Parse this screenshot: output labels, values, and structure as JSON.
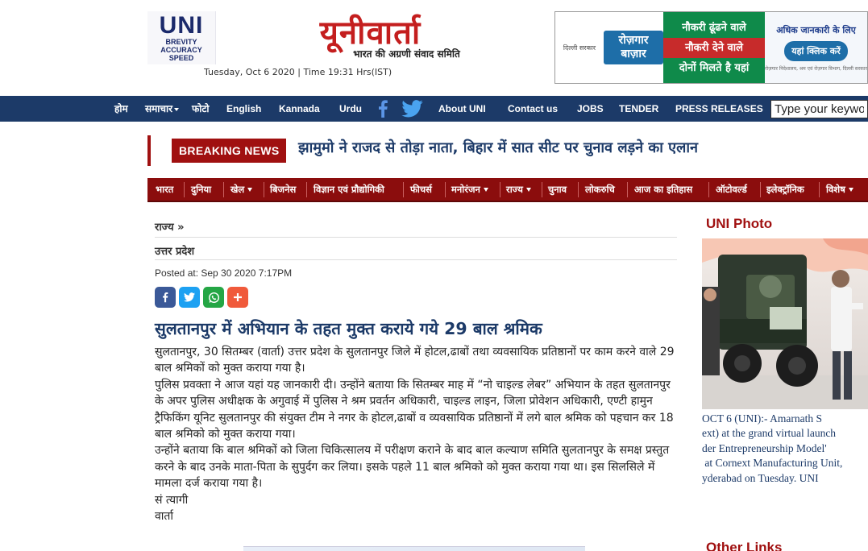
{
  "header": {
    "logo_abbr": "UNI",
    "logo_tag1": "BREVITY",
    "logo_tag2": "ACCURACY",
    "logo_tag3": "SPEED",
    "brand_hindi": "यूनीवार्ता",
    "brand_sub": "भारत की अग्रणी संवाद समिति",
    "dateline": "Tuesday, Oct 6 2020 | Time 19:31 Hrs(IST)"
  },
  "ad": {
    "govt": "दिल्ली सरकार",
    "portal": "रोज़गार बाज़ार",
    "line1": "नौकरी ढूंढने वाले",
    "line2": "नौकरी देने वाले",
    "line3": "दोनों मिलते है यहां",
    "more_info": "अधिक जानकारी के लिए",
    "click": "यहां क्लिक करें",
    "footer": "रोज़गार निदेशालय, श्रम एवं रोज़गार विभाग, दिल्ली सरकार"
  },
  "topnav": {
    "home": "होम",
    "news": "समाचार",
    "photo": "फोटो",
    "english": "English",
    "kannada": "Kannada",
    "urdu": "Urdu",
    "about": "About UNI",
    "contact": "Contact us",
    "jobs": "JOBS",
    "tender": "TENDER",
    "press": "PRESS RELEASES",
    "search_placeholder": "Type your keyword"
  },
  "breaking": {
    "label": "BREAKING NEWS",
    "headline": "झामुमो ने राजद से तोड़ा नाता, बिहार में सात सीट पर चुनाव लड़ने का एलान"
  },
  "catnav": [
    "भारत",
    "दुनिया",
    "खेल",
    "बिजनेस",
    "विज्ञान एवं प्रौद्योगिकी",
    "फीचर्स",
    "मनोरंजन",
    "राज्य",
    "चुनाव",
    "लोकरुचि",
    "आज का इतिहास",
    "ऑटोवर्ल्ड",
    "इलेक्ट्रॉनिक",
    "विशेष"
  ],
  "article": {
    "crumb1": "राज्य »",
    "crumb2": "उत्तर प्रदेश",
    "posted": "Posted at: Sep 30 2020 7:17PM",
    "title": "सुलतानपुर में अभियान के तहत मुक्त कराये गये 29 बाल श्रमिक",
    "p1": "सुलतानपुर, 30 सितम्बर (वार्ता) उत्तर प्रदेश के सुलतानपुर जिले में होटल,ढाबों तथा व्यवसायिक प्रतिष्ठानों पर काम करने वाले 29 बाल श्रमिकों को मुक्त कराया गया है।",
    "p2": "पुलिस प्रवक्ता ने आज यहां यह जानकारी दी। उन्होंने बताया कि सितम्बर माह में “नो चाइल्ड लेबर” अभियान के तहत सुलतानपुर के अपर पुलिस अधीक्षक के अगुवाई में पुलिस ने श्रम प्रवर्तन अधिकारी, चाइल्ड लाइन, जिला प्रोवेशन अधिकारी, एण्टी हामुन ट्रैफिकिंग यूनिट सुलतानपुर की संयुक्त टीम ने नगर के होटल,ढाबों व व्यवसायिक प्रतिष्ठानों में लगे बाल श्रमिक को पहचान कर 18 बाल श्रमिको को मुक्त कराया गया।",
    "p3": "उन्होंने बताया कि बाल श्रमिकों को जिला चिकित्सालय में परीक्षण कराने के बाद बाल कल्याण समिति सुलतानपुर के समक्ष प्रस्तुत करने के बाद उनके माता-पिता के सुपुर्दग कर लिया। इसके पहले 11 बाल श्रमिको को मुक्त कराया गया था। इस सिलसिले में मामला दर्ज कराया गया है।",
    "sign1": "सं त्यागी",
    "sign2": "वार्ता"
  },
  "sidebar": {
    "photo_heading": "UNI Photo",
    "caption_lines": [
      "OCT 6 (UNI):- Amarnath S",
      "ext) at the grand virtual launch",
      "der Entrepreneurship Model'",
      " at Cornext Manufacturing Unit,",
      "yderabad on Tuesday. UNI"
    ],
    "other_links": "Other Links"
  }
}
